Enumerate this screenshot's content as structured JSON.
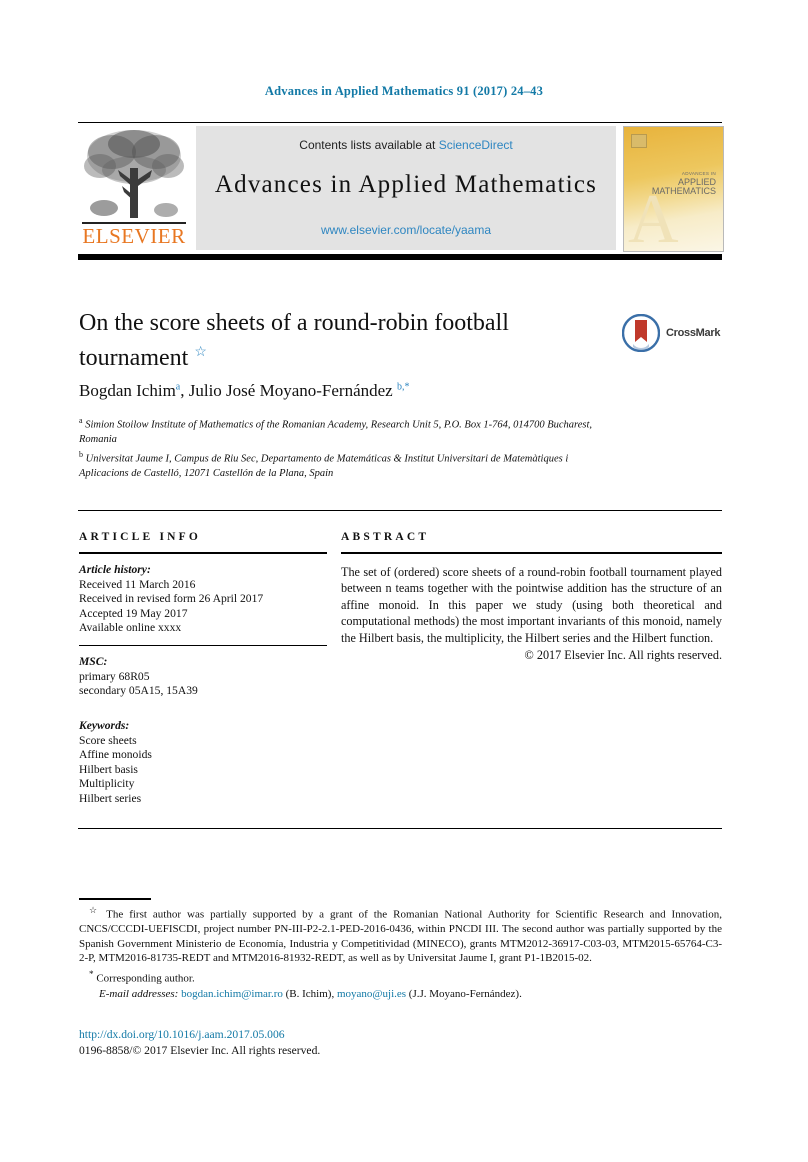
{
  "running_head": "Advances in Applied Mathematics 91 (2017) 24–43",
  "masthead": {
    "contents_prefix": "Contents lists available at ",
    "sciencedirect": "ScienceDirect",
    "journal_name": "Advances in Applied Mathematics",
    "journal_url": "www.elsevier.com/locate/yaama",
    "publisher": "ELSEVIER",
    "cover": {
      "line1": "ADVANCES IN",
      "line2": "APPLIED",
      "line3": "MATHEMATICS",
      "watermark": "A"
    }
  },
  "article": {
    "title": "On the score sheets of a round-robin football tournament",
    "title_footnote_marker": "☆",
    "crossmark_label": "CrossMark",
    "authors": "Bogdan Ichim",
    "author1": "Bogdan Ichim",
    "author1_sup": "a",
    "author2": "Julio José Moyano-Fernández",
    "author2_sup": "b,*",
    "affiliation_a_sup": "a",
    "affiliation_a": "Simion Stoilow Institute of Mathematics of the Romanian Academy, Research Unit 5, P.O. Box 1-764, 014700 Bucharest, Romania",
    "affiliation_b_sup": "b",
    "affiliation_b": "Universitat Jaume I, Campus de Riu Sec, Departamento de Matemáticas & Institut Universitari de Matemàtiques i Aplicacions de Castelló, 12071 Castellón de la Plana, Spain"
  },
  "info": {
    "heading": "ARTICLE INFO",
    "history_label": "Article history:",
    "history": [
      "Received 11 March 2016",
      "Received in revised form 26 April 2017",
      "Accepted 19 May 2017",
      "Available online xxxx"
    ],
    "msc_label": "MSC:",
    "msc": [
      "primary 68R05",
      "secondary 05A15, 15A39"
    ],
    "keywords_label": "Keywords:",
    "keywords": [
      "Score sheets",
      "Affine monoids",
      "Hilbert basis",
      "Multiplicity",
      "Hilbert series"
    ]
  },
  "abstract": {
    "heading": "ABSTRACT",
    "text": "The set of (ordered) score sheets of a round-robin football tournament played between n teams together with the pointwise addition has the structure of an affine monoid. In this paper we study (using both theoretical and computational methods) the most important invariants of this monoid, namely the Hilbert basis, the multiplicity, the Hilbert series and the Hilbert function.",
    "copyright": "© 2017 Elsevier Inc. All rights reserved."
  },
  "footnotes": {
    "funding_marker": "☆",
    "funding": "The first author was partially supported by a grant of the Romanian National Authority for Scientific Research and Innovation, CNCS/CCCDI-UEFISCDI, project number PN-III-P2-2.1-PED-2016-0436, within PNCDI III. The second author was partially supported by the Spanish Government Ministerio de Economía, Industria y Competitividad (MINECO), grants MTM2012-36917-C03-03, MTM2015-65764-C3-2-P, MTM2016-81735-REDT and MTM2016-81932-REDT, as well as by Universitat Jaume I, grant P1-1B2015-02.",
    "corresponding_marker": "*",
    "corresponding": "Corresponding author.",
    "email_label": "E-mail addresses:",
    "email1": "bogdan.ichim@imar.ro",
    "email1_owner": "(B. Ichim),",
    "email2": "moyano@uji.es",
    "email2_owner": "(J.J. Moyano-Fernández)."
  },
  "footer": {
    "doi": "http://dx.doi.org/10.1016/j.aam.2017.05.006",
    "issn": "0196-8858/© 2017 Elsevier Inc. All rights reserved."
  },
  "colors": {
    "link_blue": "#1279a6",
    "sciencedirect_blue": "#2e86c1",
    "elsevier_orange": "#e87722",
    "crossmark_blue": "#3a6fa8",
    "crossmark_red": "#c0392b",
    "cover_gold": "#e8b33c"
  }
}
